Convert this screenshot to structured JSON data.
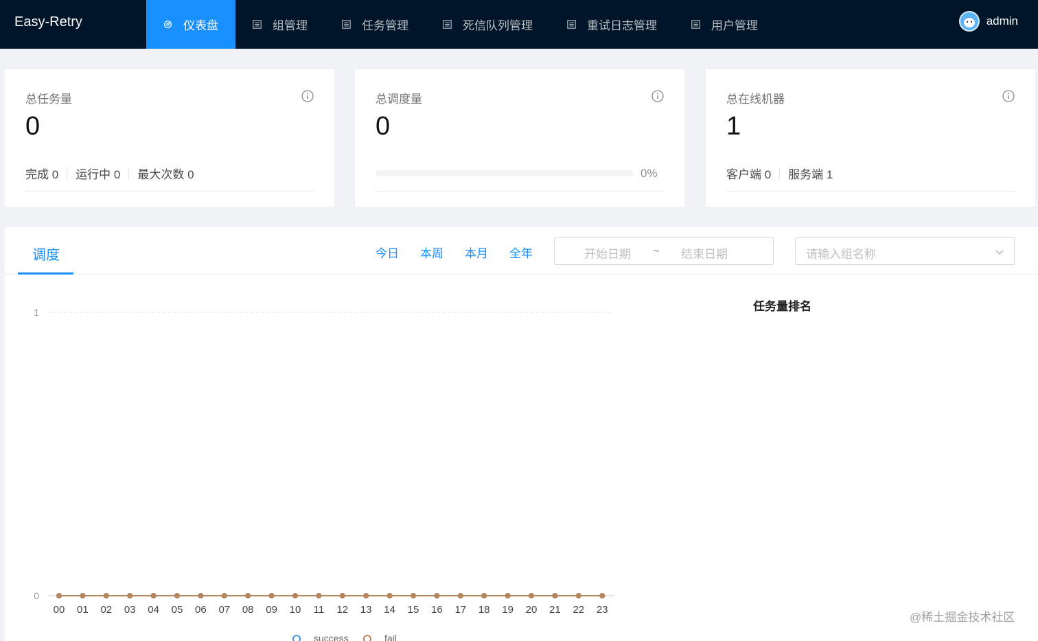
{
  "app": {
    "title": "Easy-Retry"
  },
  "nav": {
    "items": [
      {
        "label": "仪表盘",
        "icon": "dashboard-icon",
        "active": true
      },
      {
        "label": "组管理",
        "icon": "list-icon"
      },
      {
        "label": "任务管理",
        "icon": "list-icon"
      },
      {
        "label": "死信队列管理",
        "icon": "list-icon"
      },
      {
        "label": "重试日志管理",
        "icon": "list-icon"
      },
      {
        "label": "用户管理",
        "icon": "list-icon"
      }
    ]
  },
  "user": {
    "name": "admin"
  },
  "cards": {
    "total_tasks": {
      "title": "总任务量",
      "value": "0",
      "stats": [
        {
          "label": "完成 0"
        },
        {
          "label": "运行中 0"
        },
        {
          "label": "最大次数 0"
        }
      ]
    },
    "total_dispatch": {
      "title": "总调度量",
      "value": "0",
      "progress_percent": 0,
      "progress_label": "0%"
    },
    "online_machines": {
      "title": "总在线机器",
      "value": "1",
      "stats": [
        {
          "label": "客户端 0"
        },
        {
          "label": "服务端 1"
        }
      ]
    }
  },
  "panel": {
    "tab": "调度",
    "ranges": [
      "今日",
      "本周",
      "本月",
      "全年"
    ],
    "date_start_placeholder": "开始日期",
    "date_sep": "~",
    "date_end_placeholder": "结束日期",
    "group_placeholder": "请输入组名称",
    "rank_title": "任务量排名"
  },
  "chart_data": {
    "type": "line",
    "x": [
      "00",
      "01",
      "02",
      "03",
      "04",
      "05",
      "06",
      "07",
      "08",
      "09",
      "10",
      "11",
      "12",
      "13",
      "14",
      "15",
      "16",
      "17",
      "18",
      "19",
      "20",
      "21",
      "22",
      "23"
    ],
    "yticks": [
      "0",
      "1"
    ],
    "ylim": [
      0,
      1
    ],
    "series": [
      {
        "name": "success",
        "color": "#4a90e2",
        "values": [
          0,
          0,
          0,
          0,
          0,
          0,
          0,
          0,
          0,
          0,
          0,
          0,
          0,
          0,
          0,
          0,
          0,
          0,
          0,
          0,
          0,
          0,
          0,
          0
        ]
      },
      {
        "name": "fail",
        "color": "#b5865b",
        "values": [
          0,
          0,
          0,
          0,
          0,
          0,
          0,
          0,
          0,
          0,
          0,
          0,
          0,
          0,
          0,
          0,
          0,
          0,
          0,
          0,
          0,
          0,
          0,
          0
        ]
      }
    ]
  },
  "watermark": "@稀土掘金技术社区",
  "colors": {
    "header": "#001529",
    "accent": "#1890ff",
    "fail_line": "#b5865b"
  }
}
